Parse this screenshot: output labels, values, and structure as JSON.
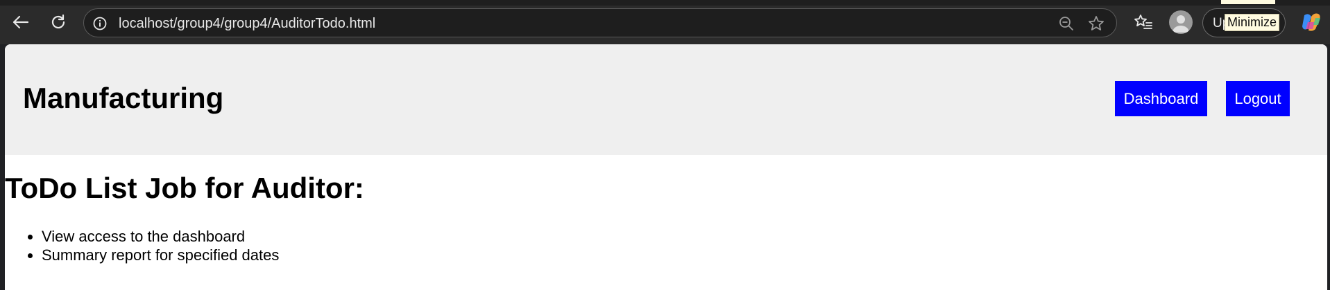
{
  "browser": {
    "url": "localhost/group4/group4/AuditorTodo.html",
    "update_label": "Up",
    "tooltip": "Minimize",
    "icons": {
      "back": "back-arrow-icon",
      "reload": "reload-icon",
      "info": "info-icon",
      "zoom": "zoom-out-icon",
      "favorite": "star-icon",
      "favorites": "favorites-list-icon",
      "profile": "avatar-icon",
      "copilot": "copilot-icon"
    }
  },
  "header": {
    "brand": "Manufacturing",
    "nav": {
      "dashboard": "Dashboard",
      "logout": "Logout"
    },
    "background": "#efefef",
    "button_color": "#0000ff"
  },
  "main": {
    "title": "ToDo List Job for Auditor:",
    "items": [
      "View access to the dashboard",
      "Summary report for specified dates"
    ]
  }
}
